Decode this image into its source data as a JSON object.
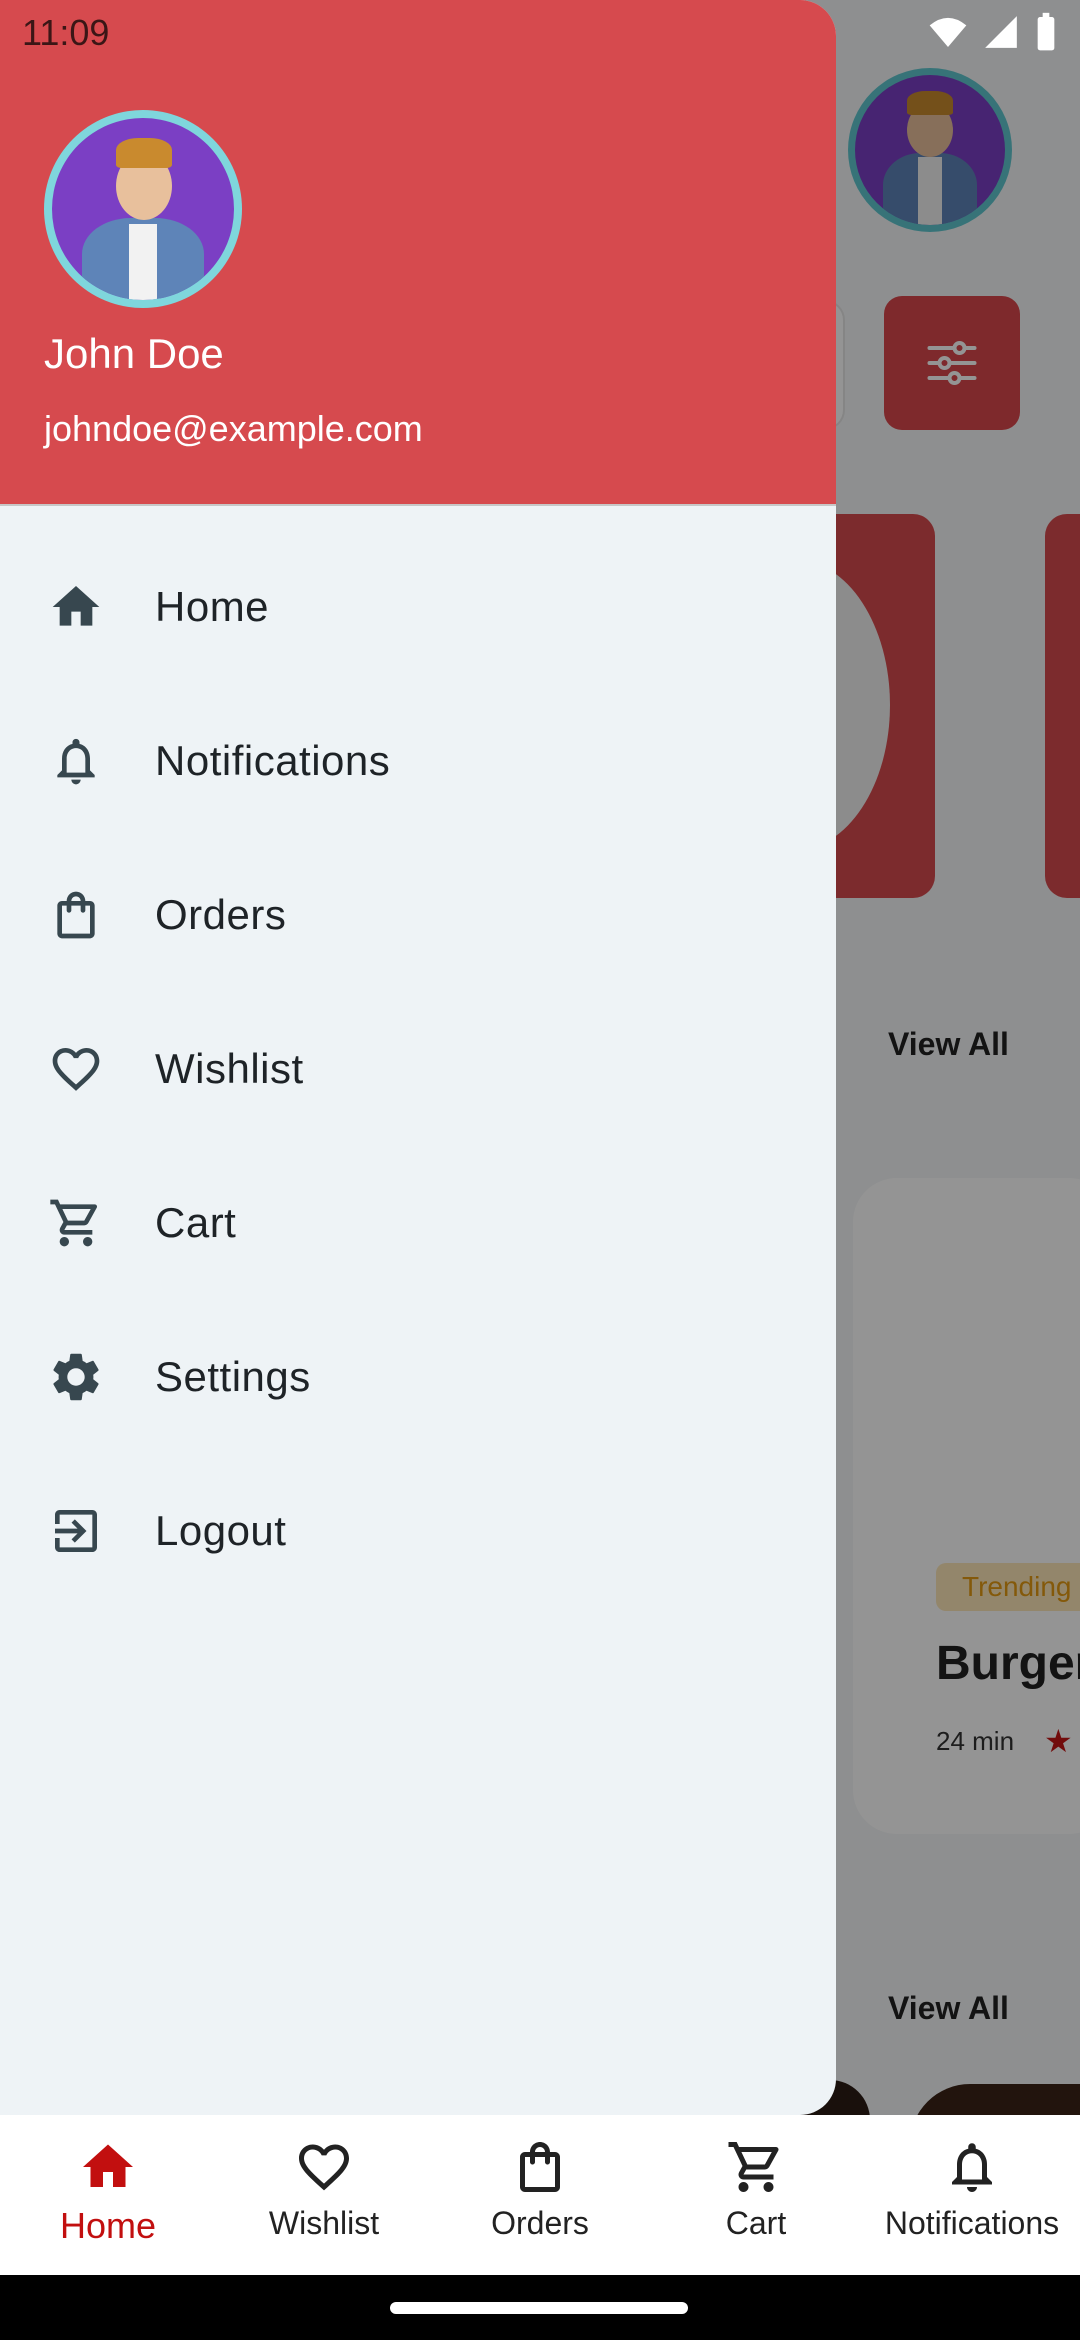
{
  "status_bar": {
    "time": "11:09"
  },
  "drawer": {
    "user": {
      "name": "John Doe",
      "email": "johndoe@example.com"
    },
    "menu": [
      {
        "label": "Home",
        "icon": "home-icon"
      },
      {
        "label": "Notifications",
        "icon": "bell-icon"
      },
      {
        "label": "Orders",
        "icon": "shopping-bag-icon"
      },
      {
        "label": "Wishlist",
        "icon": "heart-icon"
      },
      {
        "label": "Cart",
        "icon": "cart-icon"
      },
      {
        "label": "Settings",
        "icon": "gear-icon"
      },
      {
        "label": "Logout",
        "icon": "logout-icon"
      }
    ]
  },
  "background": {
    "view_all_1": "View All",
    "view_all_2": "View All",
    "food_card": {
      "badge": "Trending",
      "title": "Burger",
      "time": "24 min"
    }
  },
  "bottom_nav": {
    "items": [
      {
        "label": "Home",
        "icon": "home-icon",
        "active": true
      },
      {
        "label": "Wishlist",
        "icon": "heart-icon"
      },
      {
        "label": "Orders",
        "icon": "shopping-bag-icon"
      },
      {
        "label": "Cart",
        "icon": "cart-icon"
      },
      {
        "label": "Notifications",
        "icon": "bell-icon"
      }
    ]
  },
  "colors": {
    "brand_red": "#d64a4e",
    "active_nav": "#c20f0f",
    "drawer_bg": "#eef3f6",
    "avatar_ring": "#7fd6dc"
  }
}
